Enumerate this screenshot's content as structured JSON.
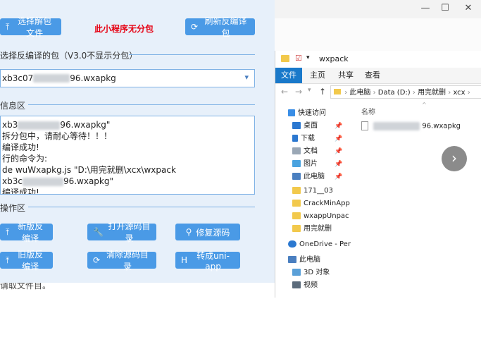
{
  "window_controls": {
    "minimize": "—",
    "maximize": "☐",
    "close": "✕"
  },
  "tool": {
    "select_pkg_button": "选择解包文件",
    "promo_text": "此小程序无分包",
    "refresh_button": "刷新反编译包",
    "package_section_label": "选择反编译的包（V3.0不显示分包）",
    "selected_package_prefix": "xb3c07",
    "selected_package_suffix": "96.wxapkg",
    "info_section_label": "信息区",
    "log_lines": [
      {
        "pre": "xb3",
        "post": "96.wxapkg\""
      },
      {
        "pre": "拆分包中，请耐心等待！！！",
        "post": ""
      },
      {
        "pre": "编译成功!",
        "post": ""
      },
      {
        "pre": "行的命令为:",
        "post": ""
      },
      {
        "pre": "de wuWxapkg.js \"D:\\用完就删\\xcx\\wxpack",
        "post": ""
      },
      {
        "pre": "xb3c",
        "post": "96.wxapkg\""
      },
      {
        "pre": "编译成功!",
        "post": ""
      }
    ],
    "ops_section_label": "操作区",
    "buttons": {
      "new_decompile": "新版反编译",
      "open_source_dir": "打开源码目录",
      "fix_source": "修复源码",
      "old_decompile": "旧版反编译",
      "clear_source_dir": "清除源码目录",
      "convert_uniapp": "转成uni-app"
    },
    "icons": {
      "select_pkg": "upload-icon",
      "refresh": "refresh-icon",
      "new_decompile": "upload-icon",
      "open_source_dir": "wrench-icon",
      "fix_source": "search-icon",
      "old_decompile": "upload-icon",
      "clear_source_dir": "refresh-icon",
      "convert_uniapp": "h-icon"
    },
    "bottom_text": "请取文件目。"
  },
  "explorer": {
    "title": "wxpack",
    "ribbon_tabs": [
      "文件",
      "主页",
      "共享",
      "查看"
    ],
    "path": [
      "此电脑",
      "Data (D:)",
      "用完就删",
      "xcx"
    ],
    "nav": [
      {
        "label": "快速访问",
        "pinned": false
      },
      {
        "label": "桌面",
        "pinned": true
      },
      {
        "label": "下载",
        "pinned": true
      },
      {
        "label": "文档",
        "pinned": true
      },
      {
        "label": "图片",
        "pinned": true
      },
      {
        "label": "此电脑",
        "pinned": true
      },
      {
        "label": "171__03",
        "pinned": false
      },
      {
        "label": "CrackMinApp",
        "pinned": false
      },
      {
        "label": "wxappUnpac",
        "pinned": false
      },
      {
        "label": "用完就删",
        "pinned": false
      },
      {
        "label": "OneDrive - Per",
        "pinned": false
      },
      {
        "label": "此电脑",
        "pinned": false
      },
      {
        "label": "3D 对象",
        "pinned": false
      },
      {
        "label": "视频",
        "pinned": false
      }
    ],
    "column_name": "名称",
    "file_suffix": "96.wxapkg",
    "next_arrow": "›"
  },
  "colors": {
    "accent": "#4a9ae6",
    "panel_bg": "#e7f0fa",
    "promo": "#e60012",
    "explorer_file_tab": "#1979ca"
  }
}
